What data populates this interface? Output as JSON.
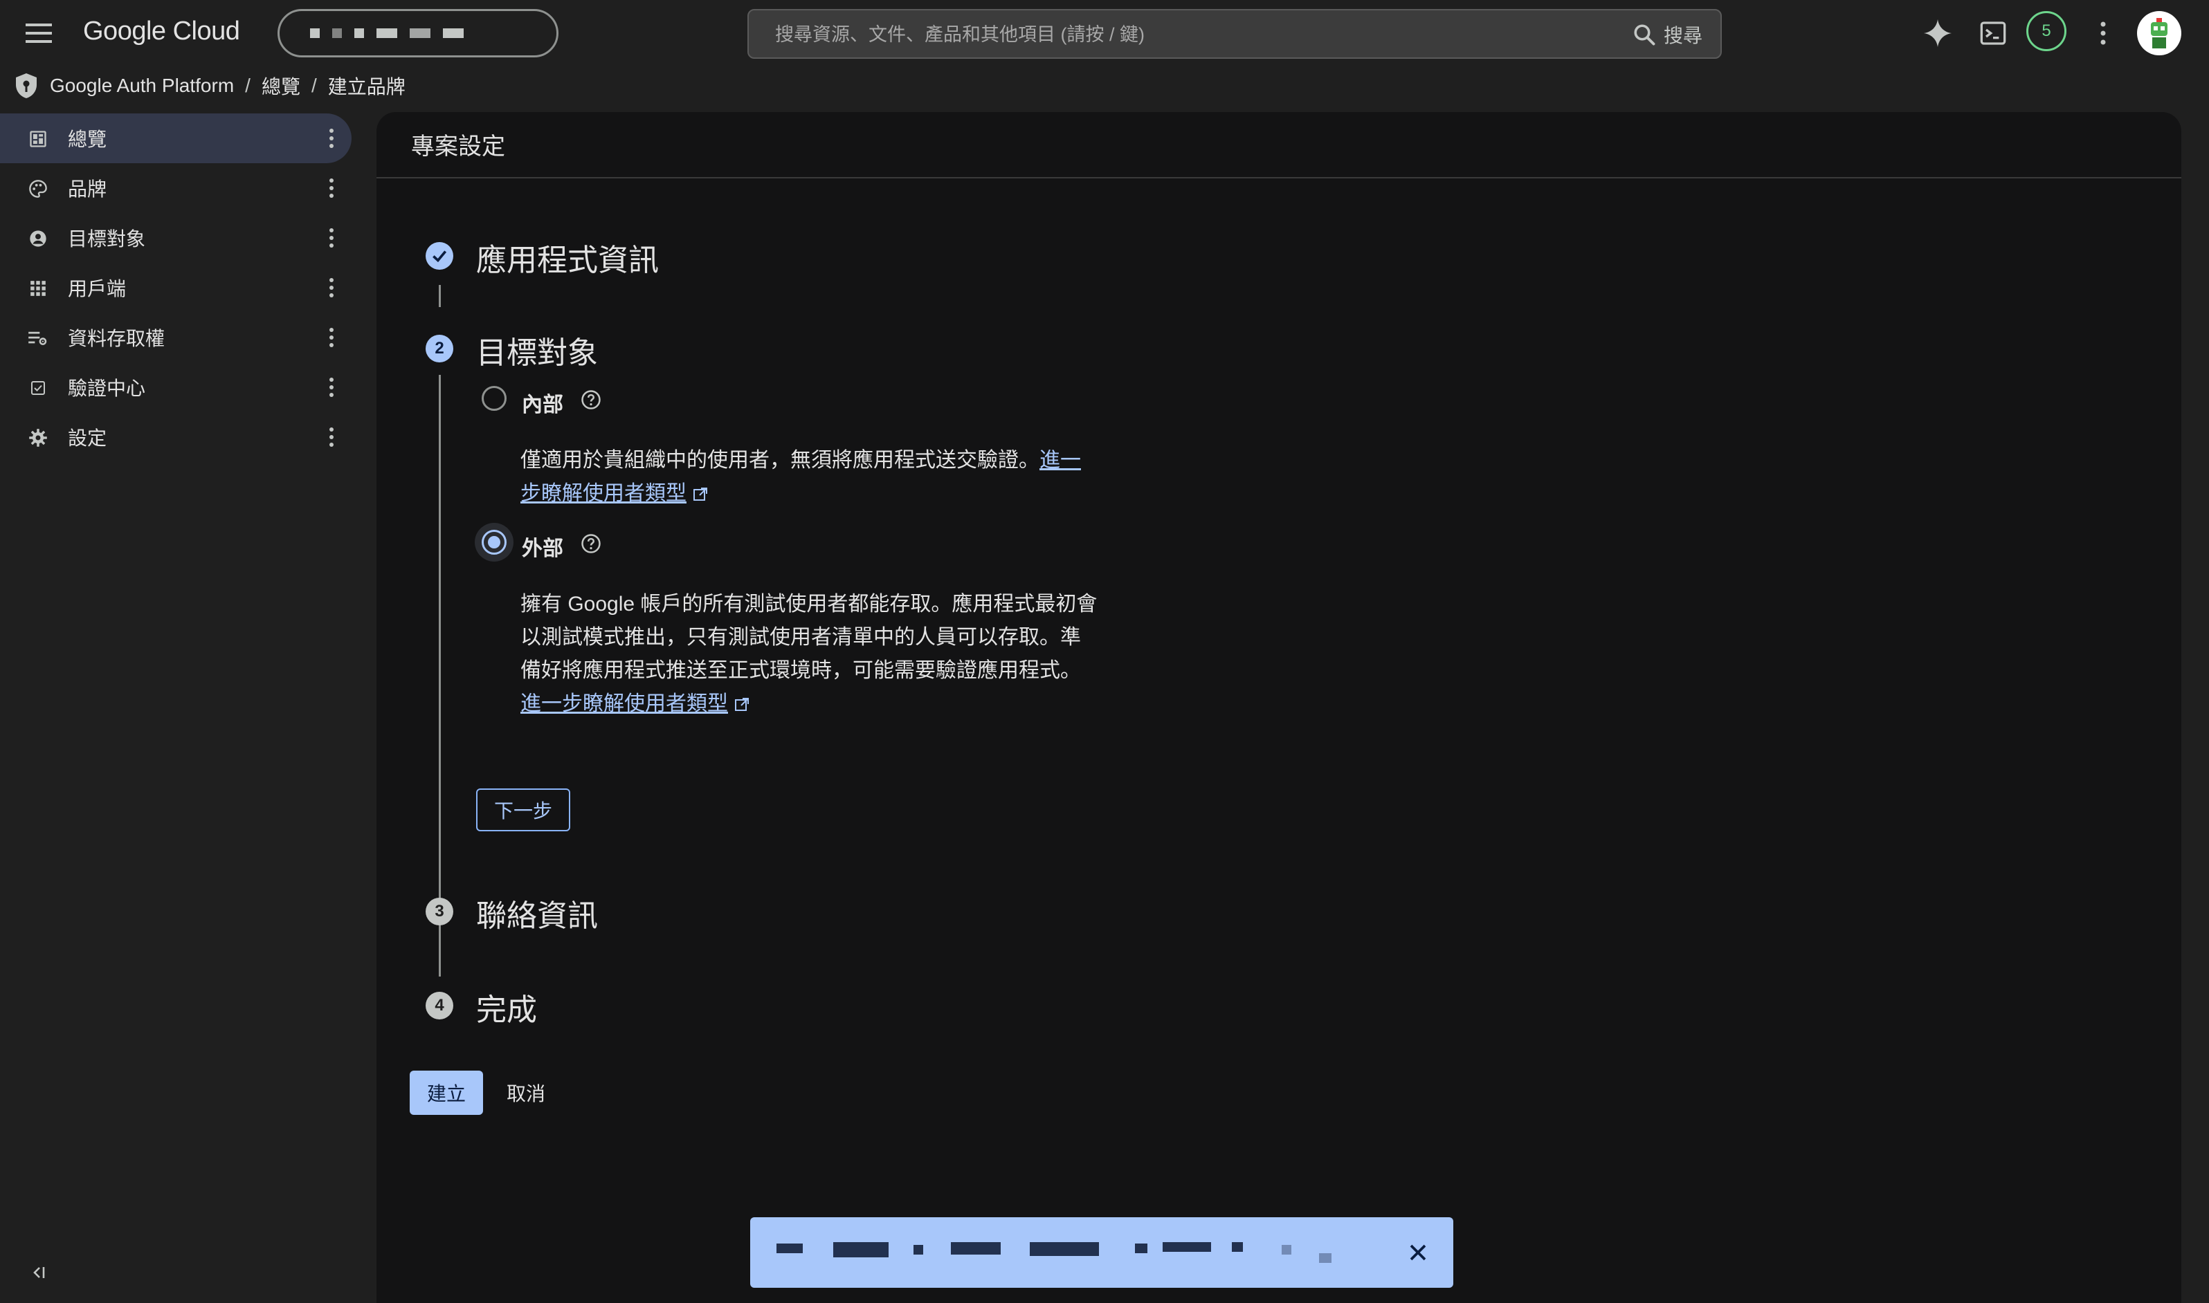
{
  "topbar": {
    "logo": "Google Cloud",
    "search_placeholder": "搜尋資源、文件、產品和其他項目 (請按 / 鍵)",
    "search_button": "搜尋",
    "notification_count": "5"
  },
  "breadcrumb": {
    "product": "Google Auth Platform",
    "parent": "總覽",
    "current": "建立品牌"
  },
  "sidebar": {
    "items": [
      {
        "label": "總覽",
        "icon": "dashboard-icon",
        "active": true
      },
      {
        "label": "品牌",
        "icon": "palette-icon"
      },
      {
        "label": "目標對象",
        "icon": "account-circle-icon"
      },
      {
        "label": "用戶端",
        "icon": "apps-grid-icon"
      },
      {
        "label": "資料存取權",
        "icon": "data-access-icon"
      },
      {
        "label": "驗證中心",
        "icon": "check-box-icon"
      },
      {
        "label": "設定",
        "icon": "gear-icon"
      }
    ]
  },
  "panel": {
    "title": "專案設定"
  },
  "steps": [
    {
      "title": "應用程式資訊",
      "status": "done"
    },
    {
      "number": "2",
      "title": "目標對象",
      "status": "current"
    },
    {
      "number": "3",
      "title": "聯絡資訊",
      "status": "pending"
    },
    {
      "number": "4",
      "title": "完成",
      "status": "pending"
    }
  ],
  "audience": {
    "internal": {
      "label": "內部",
      "selected": false,
      "description": "僅適用於貴組織中的使用者，無須將應用程式送交驗證。",
      "link_line1": "進一",
      "link_line2": "步瞭解使用者類型"
    },
    "external": {
      "label": "外部",
      "selected": true,
      "desc_line1": "擁有 Google 帳戶的所有測試使用者都能存取。應用程式最初會",
      "desc_line2": "以測試模式推出，只有測試使用者清單中的人員可以存取。準",
      "desc_line3": "備好將應用程式推送至正式環境時，可能需要驗證應用程式。",
      "link": "進一步瞭解使用者類型"
    }
  },
  "buttons": {
    "next": "下一步",
    "create": "建立",
    "cancel": "取消"
  },
  "colors": {
    "accent": "#a8c7fa",
    "background": "#1f1f1f",
    "panel": "#131314",
    "badge": "#6dd58c"
  }
}
